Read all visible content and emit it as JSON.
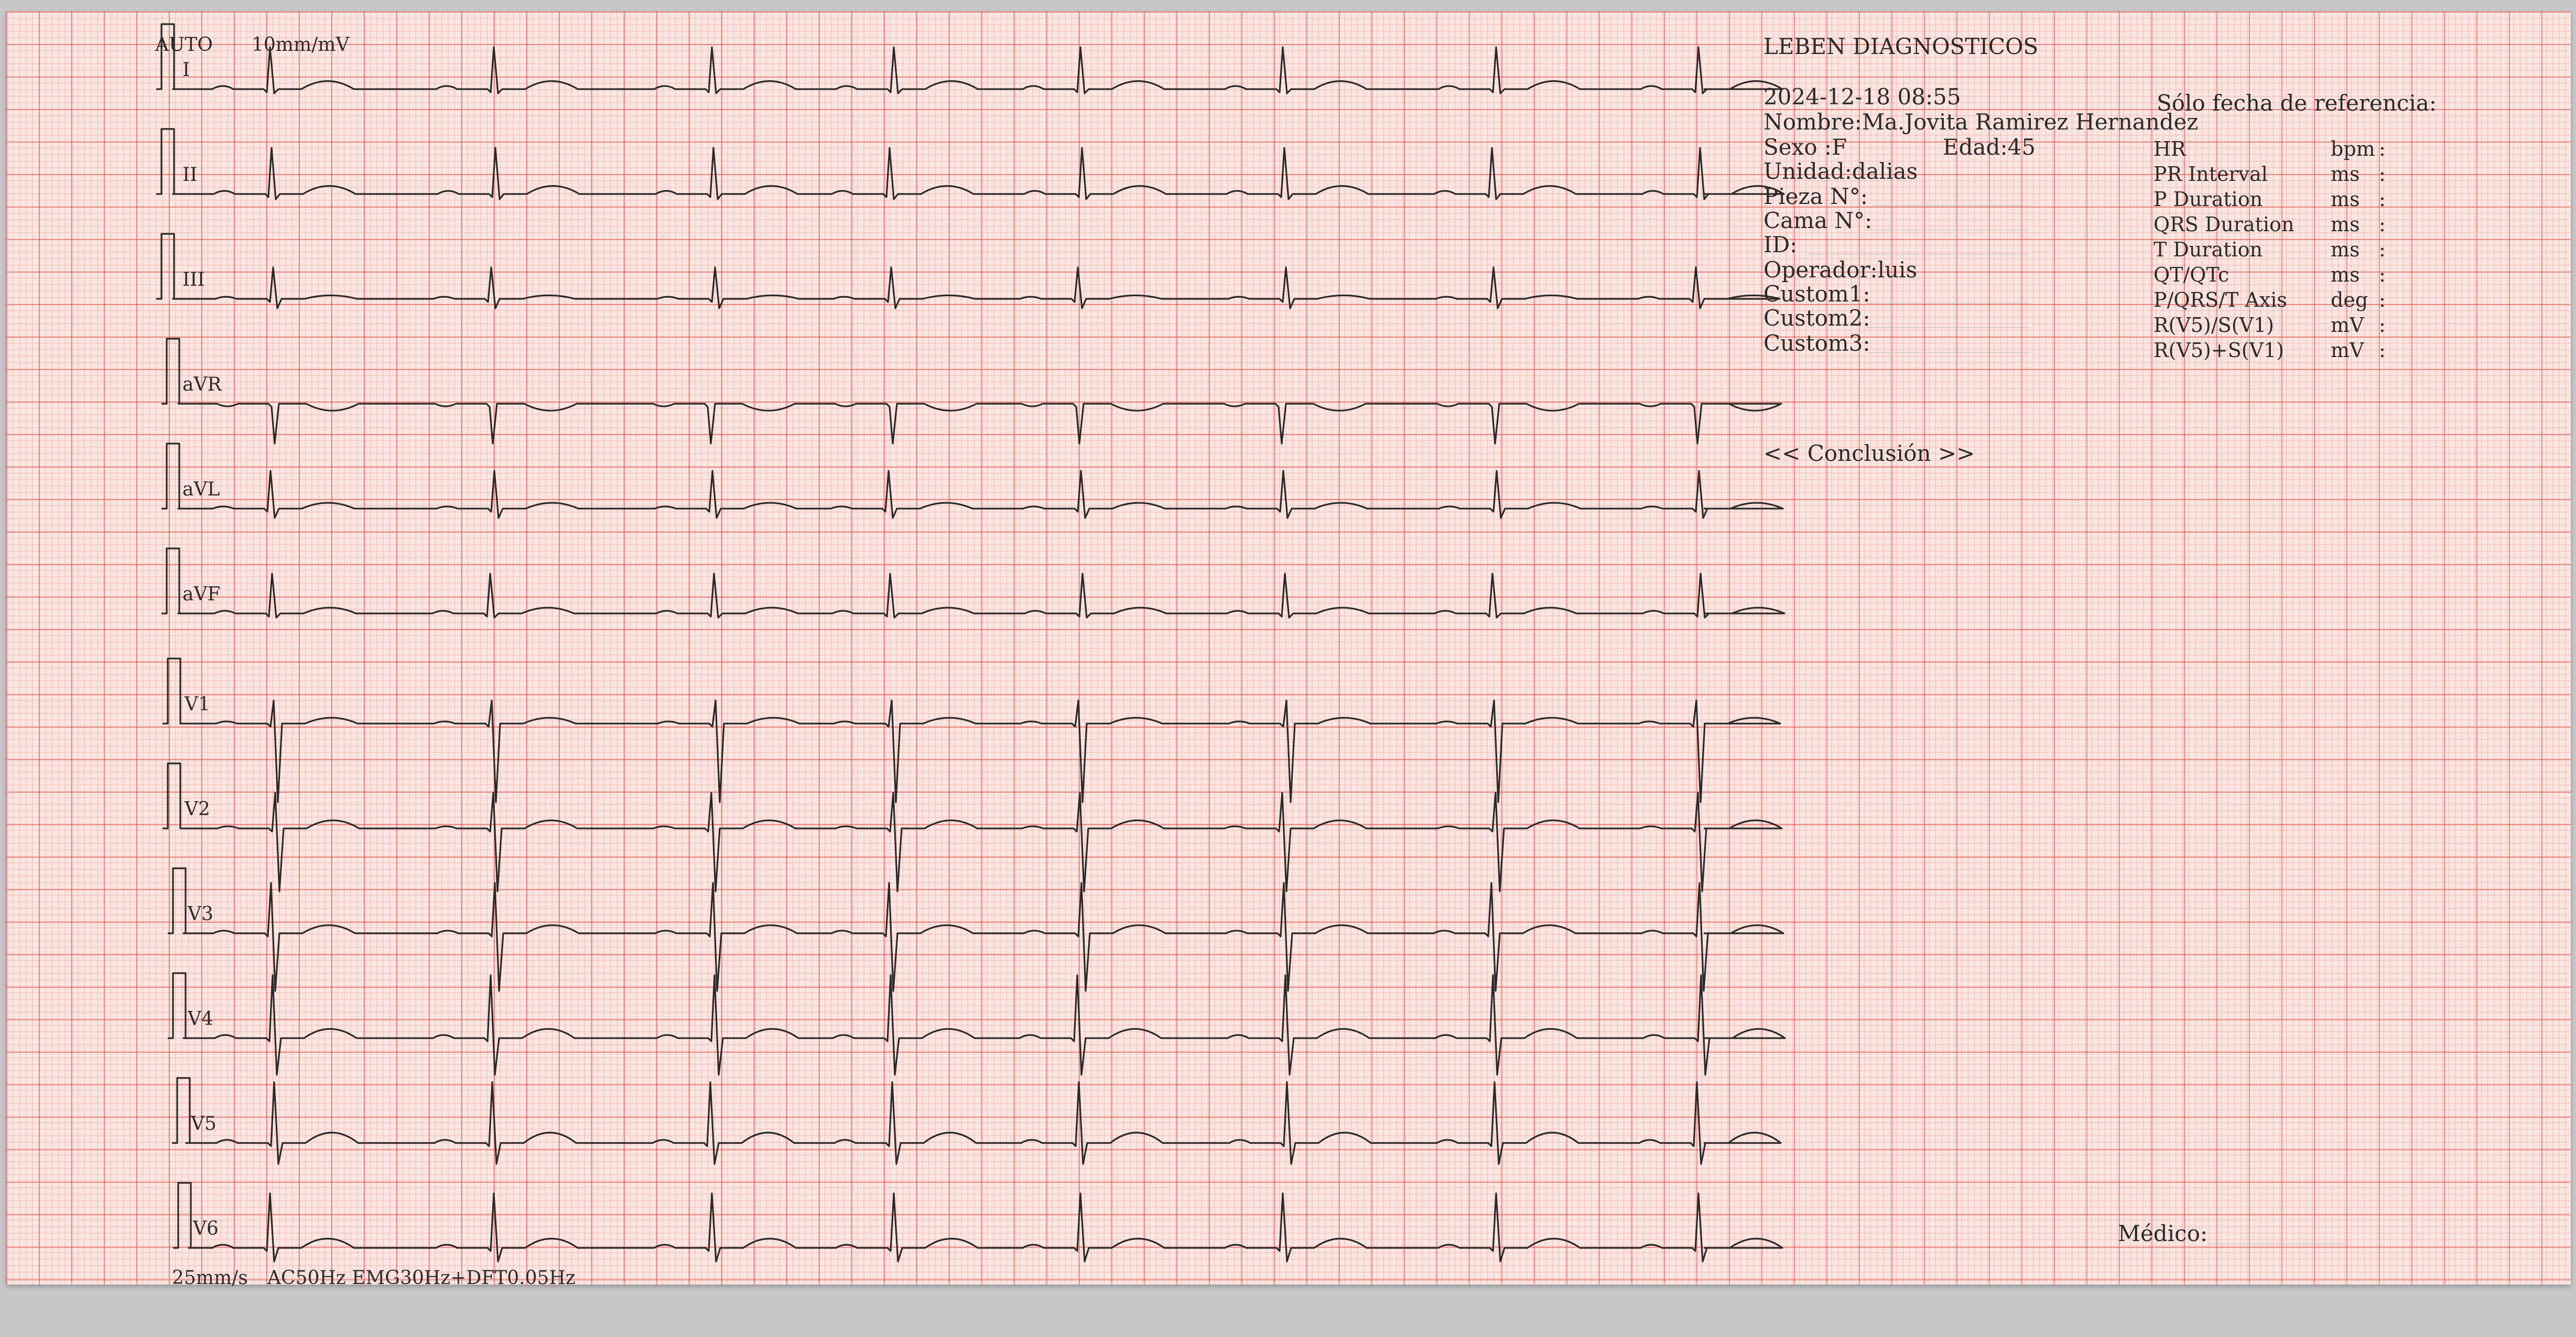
{
  "header": {
    "gain_mode": "AUTO",
    "gain": "10mm/mV",
    "institution": "LEBEN DIAGNOSTICOS",
    "datetime": "2024-12-18 08:55"
  },
  "patient": {
    "nombre_label": "Nombre:",
    "nombre": "Ma.Jovita Ramirez Hernandez",
    "sexo_label": "Sexo  :",
    "sexo": "F",
    "edad_label": "Edad:",
    "edad": "45",
    "unidad_label": "Unidad:",
    "unidad": "dalias",
    "pieza_label": "Pieza N°:",
    "cama_label": "Cama N°:",
    "id_label": "ID:",
    "operador_label": "Operador:",
    "operador": "luis",
    "custom1_label": "Custom1:",
    "custom2_label": "Custom2:",
    "custom3_label": "Custom3:"
  },
  "measurements": {
    "reference_note": "Sólo fecha de referencia:",
    "rows": [
      {
        "label": "HR",
        "unit": "bpm",
        "value": ":"
      },
      {
        "label": "PR Interval",
        "unit": "ms",
        "value": ":"
      },
      {
        "label": "P Duration",
        "unit": "ms",
        "value": ":"
      },
      {
        "label": "QRS Duration",
        "unit": "ms",
        "value": ":"
      },
      {
        "label": "T Duration",
        "unit": "ms",
        "value": ":"
      },
      {
        "label": "QT/QTc",
        "unit": "ms",
        "value": ":"
      },
      {
        "label": "P/QRS/T Axis",
        "unit": "deg",
        "value": ":"
      },
      {
        "label": "R(V5)/S(V1)",
        "unit": "mV",
        "value": ":"
      },
      {
        "label": "R(V5)+S(V1)",
        "unit": "mV",
        "value": ":"
      }
    ]
  },
  "conclusion_label": "<< Conclusión >>",
  "medico_label": "Médico:",
  "footer": {
    "speed": "25mm/s",
    "filters": "AC50Hz EMG30Hz+DFT0.05Hz"
  },
  "leads": [
    "I",
    "II",
    "III",
    "aVR",
    "aVL",
    "aVF",
    "V1",
    "V2",
    "V3",
    "V4",
    "V5",
    "V6"
  ],
  "colors": {
    "paper": "#fbe6e2",
    "grid_major": "#dc463c",
    "grid_minor": "#ec8278",
    "trace": "#2a2a2a"
  }
}
